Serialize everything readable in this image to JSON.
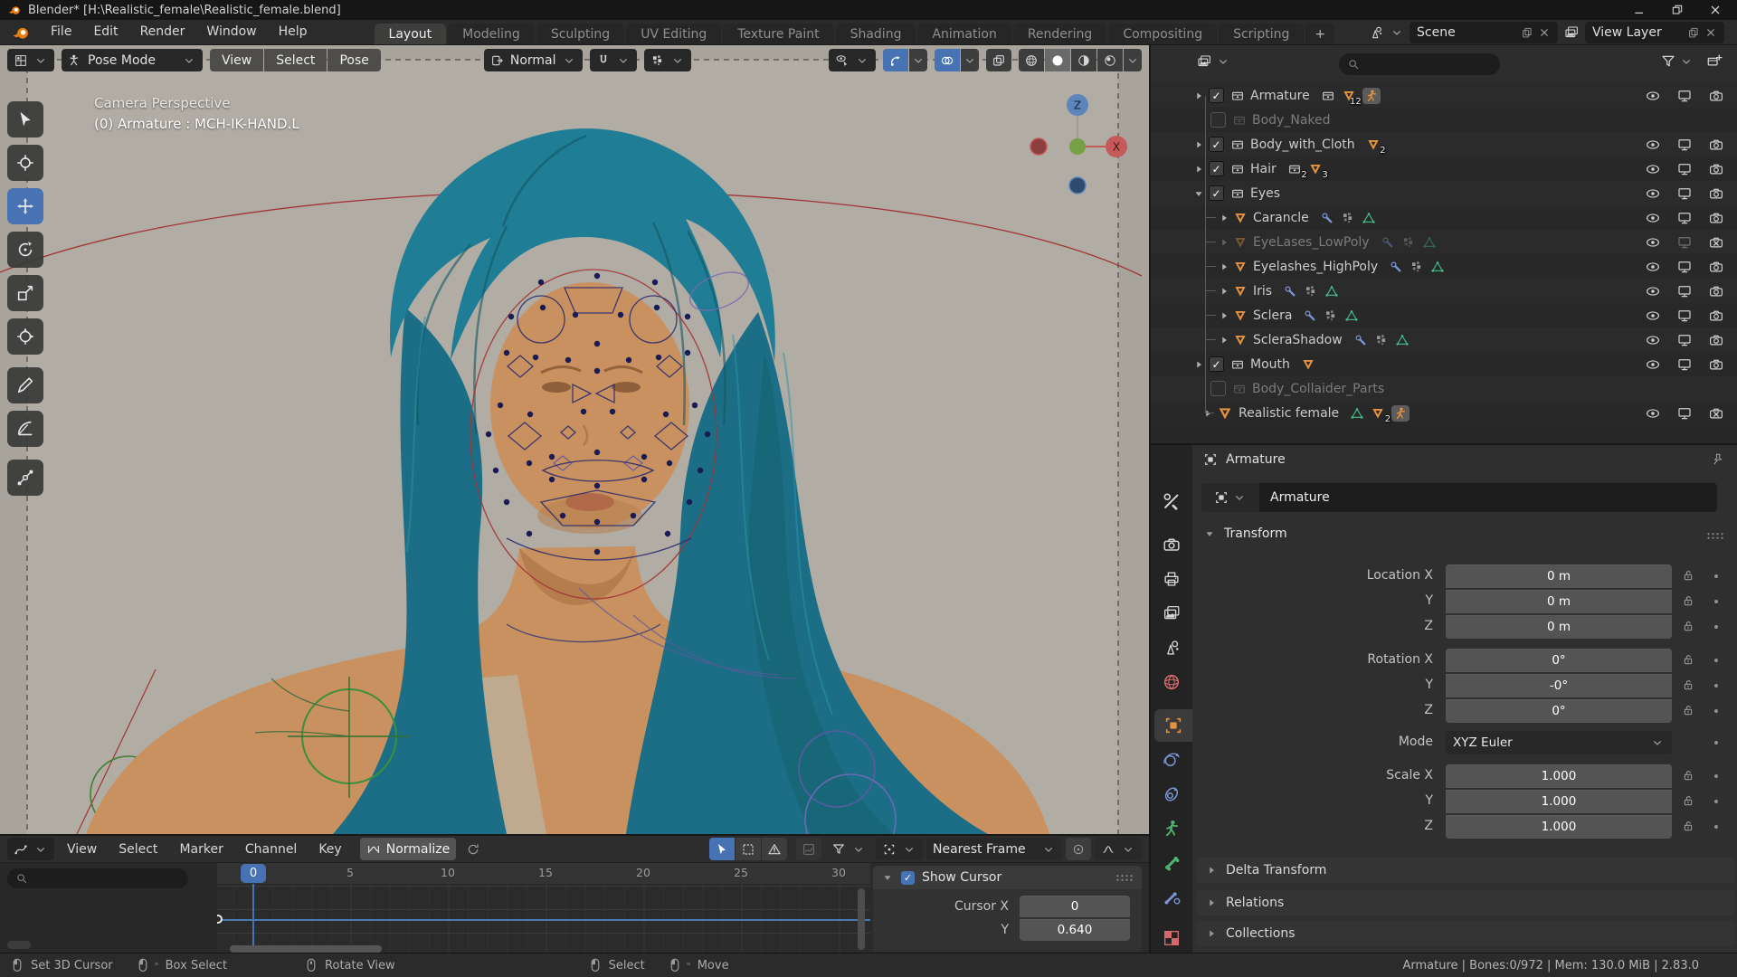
{
  "window": {
    "title": "Blender* [H:\\Realistic_female\\Realistic_female.blend]"
  },
  "topbar": {
    "menus": [
      "File",
      "Edit",
      "Render",
      "Window",
      "Help"
    ],
    "tabs": [
      "Layout",
      "Modeling",
      "Sculpting",
      "UV Editing",
      "Texture Paint",
      "Shading",
      "Animation",
      "Rendering",
      "Compositing",
      "Scripting"
    ],
    "new_tab_label": "+",
    "scene": {
      "value": "Scene"
    },
    "view_layer": {
      "value": "View Layer"
    }
  },
  "viewport": {
    "header": {
      "mode": "Pose Mode",
      "menus": [
        "View",
        "Select",
        "Pose"
      ],
      "orientation": "Normal"
    },
    "overlay": {
      "line1": "Camera Perspective",
      "line2": "(0) Armature : MCH-IK-HAND.L"
    },
    "gizmo": {
      "z": "Z",
      "x": "X"
    }
  },
  "outliner": {
    "rows": [
      {
        "label": "Armature",
        "mesh_count": "12"
      },
      {
        "label": "Body_Naked"
      },
      {
        "label": "Body_with_Cloth",
        "mesh_count": "2"
      },
      {
        "label": "Hair",
        "collection_count": "2",
        "mesh_count": "3"
      },
      {
        "label": "Eyes"
      },
      {
        "label": "Carancle"
      },
      {
        "label": "EyeLases_LowPoly"
      },
      {
        "label": "Eyelashes_HighPoly"
      },
      {
        "label": "Iris"
      },
      {
        "label": "Sclera"
      },
      {
        "label": "ScleraShadow"
      },
      {
        "label": "Mouth"
      },
      {
        "label": "Body_Collaider_Parts"
      },
      {
        "label": "Realistic female",
        "mesh_count": "2"
      }
    ]
  },
  "properties": {
    "breadcrumb": "Armature",
    "object_name": "Armature",
    "transform": {
      "title": "Transform",
      "rows": [
        {
          "label": "Location X",
          "value": "0 m"
        },
        {
          "label": "Y",
          "value": "0 m"
        },
        {
          "label": "Z",
          "value": "0 m"
        },
        {
          "label": "Rotation X",
          "value": "0°"
        },
        {
          "label": "Y",
          "value": "-0°"
        },
        {
          "label": "Z",
          "value": "0°"
        },
        {
          "label": "Mode",
          "value": "XYZ Euler"
        },
        {
          "label": "Scale X",
          "value": "1.000"
        },
        {
          "label": "Y",
          "value": "1.000"
        },
        {
          "label": "Z",
          "value": "1.000"
        }
      ]
    },
    "panels": [
      "Delta Transform",
      "Relations",
      "Collections"
    ]
  },
  "graph": {
    "menus": [
      "View",
      "Select",
      "Marker",
      "Channel",
      "Key"
    ],
    "normalize_label": "Normalize",
    "snap": "Nearest Frame",
    "current_frame": "0",
    "ticks": [
      "5",
      "10",
      "15",
      "20",
      "25",
      "30"
    ],
    "cursor_panel": {
      "title": "Show Cursor",
      "x_label": "Cursor X",
      "x_value": "0",
      "y_label": "Y",
      "y_value": "0.640"
    }
  },
  "statusbar": {
    "hints": [
      "Set 3D Cursor",
      "Box Select",
      "Rotate View",
      "Select",
      "Move"
    ],
    "info": "Armature | Bones:0/972  | Mem: 130.0 MiB | 2.83.0"
  }
}
